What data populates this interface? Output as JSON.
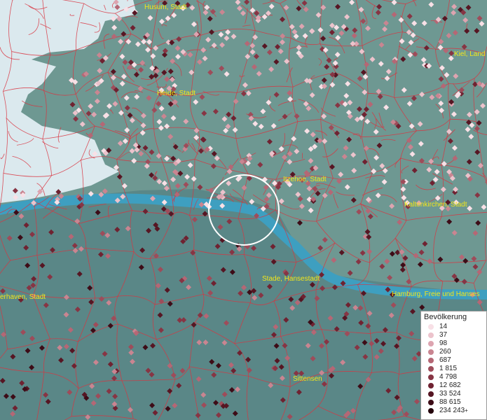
{
  "map": {
    "place_labels": [
      {
        "id": "husum",
        "text": "Husum, Stadt"
      },
      {
        "id": "kiel",
        "text": "Kiel, Land"
      },
      {
        "id": "heide",
        "text": "Heide, Stadt"
      },
      {
        "id": "itzehoe",
        "text": "Itzehoe, Stadt"
      },
      {
        "id": "kaltenkirchen",
        "text": "Kaltenkirchen, Stadt"
      },
      {
        "id": "stade",
        "text": "Stade, Hansestadt"
      },
      {
        "id": "bremerhaven",
        "text": "erhaven, Stadt"
      },
      {
        "id": "hamburg",
        "text": "Hamburg, Freie und Hanses"
      },
      {
        "id": "sittensen",
        "text": "Sittensen"
      }
    ],
    "colors": {
      "sea": "#dbe9ee",
      "land_north": "#6e9892",
      "land_south": "#5a8787",
      "river": "#3e9fc0",
      "boundary": "#d9343f",
      "label": "#f2e61a",
      "selection_ring": "#ffffff"
    }
  },
  "legend": {
    "title": "Bevölkerung",
    "entries": [
      {
        "label": "14",
        "color": "#f8e0e6"
      },
      {
        "label": "37",
        "color": "#ecc3cc"
      },
      {
        "label": "98",
        "color": "#dda4b0"
      },
      {
        "label": "260",
        "color": "#c98591"
      },
      {
        "label": "687",
        "color": "#b56775"
      },
      {
        "label": "1 815",
        "color": "#9e4c5a"
      },
      {
        "label": "4 798",
        "color": "#873544"
      },
      {
        "label": "12 682",
        "color": "#6f2231"
      },
      {
        "label": "33 524",
        "color": "#561623"
      },
      {
        "label": "88 615",
        "color": "#3d0c17"
      },
      {
        "label": "234 243",
        "color": "#24040b",
        "suffix": "+"
      }
    ]
  }
}
